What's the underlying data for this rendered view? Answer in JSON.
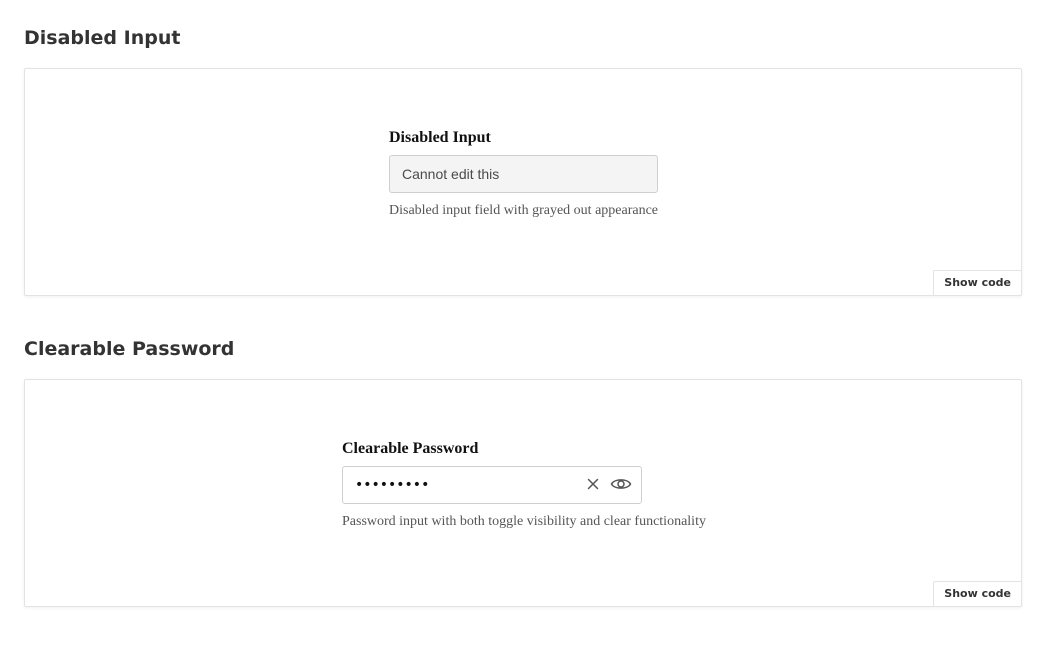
{
  "sections": [
    {
      "title": "Disabled Input",
      "field_label": "Disabled Input",
      "input_value": "Cannot edit this",
      "help_text": "Disabled input field with grayed out appearance",
      "show_code_label": "Show code"
    },
    {
      "title": "Clearable Password",
      "field_label": "Clearable Password",
      "input_value": "secret123",
      "help_text": "Password input with both toggle visibility and clear functionality",
      "show_code_label": "Show code",
      "icons": [
        "clear-icon",
        "eye-icon"
      ]
    }
  ],
  "colors": {
    "text": "#333333",
    "border": "#cfcfcf",
    "disabled_bg": "#f4f4f4",
    "help_text": "#555555"
  }
}
